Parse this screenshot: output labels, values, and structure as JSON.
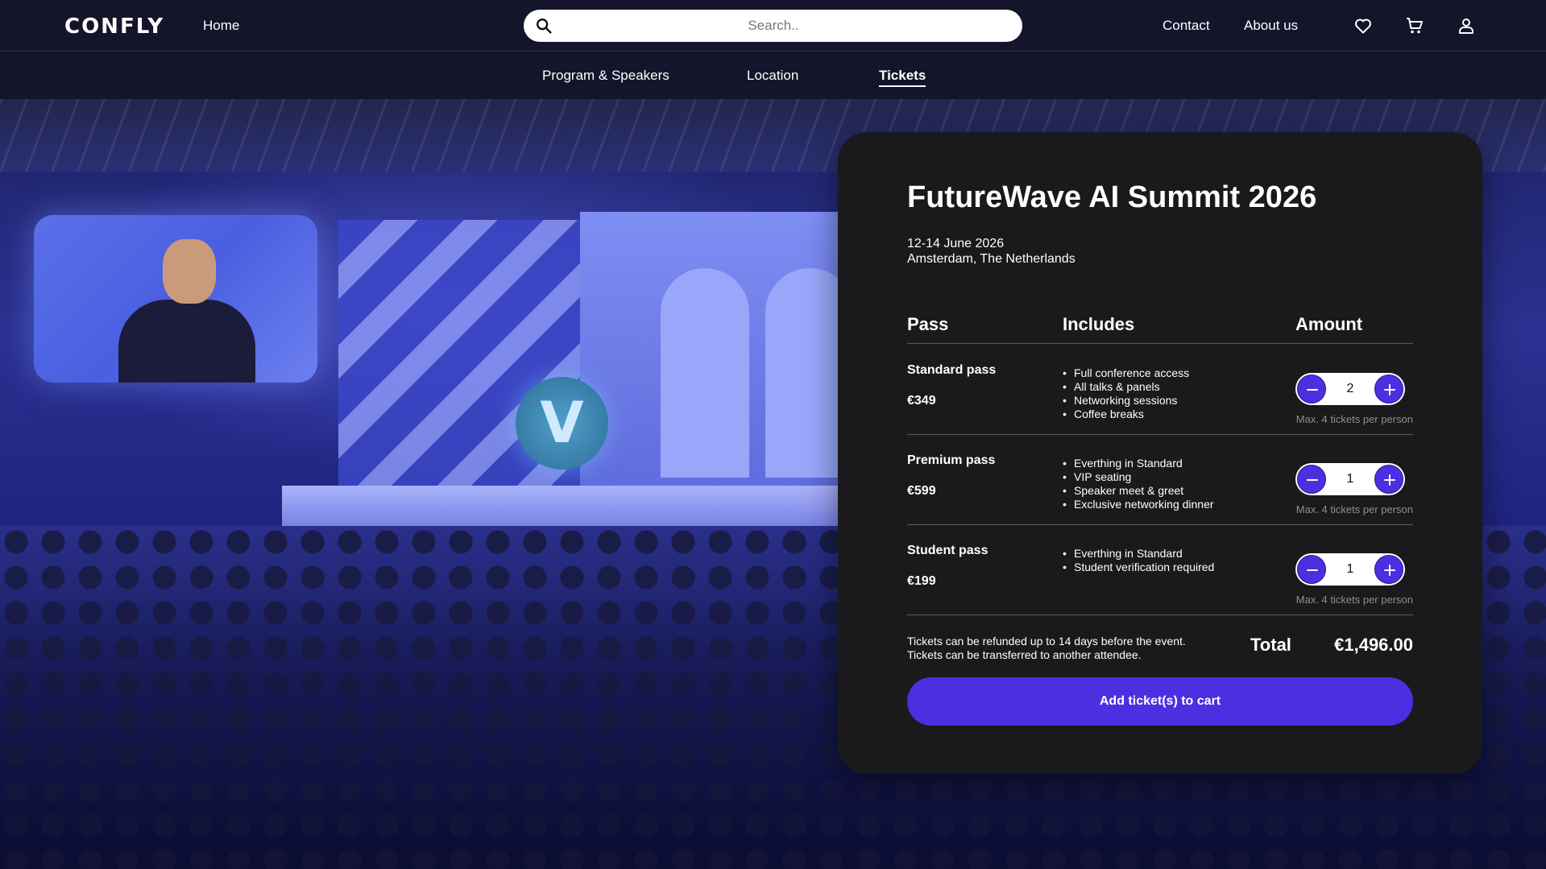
{
  "header": {
    "logo": "CONFLY",
    "home_label": "Home",
    "search": {
      "placeholder": "Search..",
      "value": ""
    },
    "contact_label": "Contact",
    "about_label": "About us",
    "icons": [
      "heart-icon",
      "cart-icon",
      "user-icon"
    ]
  },
  "subnav": {
    "items": [
      {
        "label": "Program & Speakers",
        "active": false
      },
      {
        "label": "Location",
        "active": false
      },
      {
        "label": "Tickets",
        "active": true
      }
    ]
  },
  "hero": {
    "stage_logo": "V"
  },
  "event": {
    "title": "FutureWave AI Summit 2026",
    "date": "12-14 June 2026",
    "location": "Amsterdam, The Netherlands"
  },
  "table": {
    "headers": {
      "pass": "Pass",
      "includes": "Includes",
      "amount": "Amount"
    },
    "max_note": "Max. 4 tickets per person",
    "rows": [
      {
        "name": "Standard pass",
        "price": "€349",
        "quantity": "2",
        "includes": [
          "Full conference access",
          "All talks & panels",
          "Networking sessions",
          "Coffee breaks"
        ]
      },
      {
        "name": "Premium pass",
        "price": "€599",
        "quantity": "1",
        "includes": [
          "Everthing in Standard",
          "VIP seating",
          "Speaker meet & greet",
          "Exclusive networking dinner"
        ]
      },
      {
        "name": "Student pass",
        "price": "€199",
        "quantity": "1",
        "includes": [
          "Everthing in Standard",
          "Student verification required"
        ]
      }
    ]
  },
  "footer": {
    "refund_line_1": "Tickets can be refunded up to 14 days before the event.",
    "refund_line_2": "Tickets can be transferred to another attendee.",
    "total_label": "Total",
    "total_value": "€1,496.00",
    "cart_button": "Add ticket(s) to cart"
  },
  "colors": {
    "accent": "#4c2fe0",
    "card_bg": "#1a1a1c",
    "nav_bg": "#14142a"
  }
}
